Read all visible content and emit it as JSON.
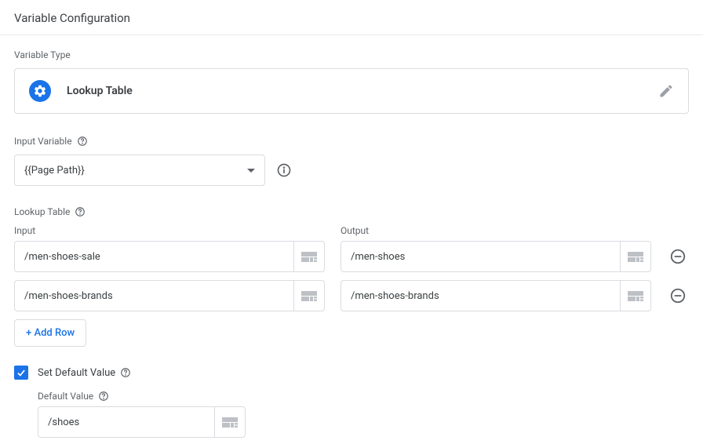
{
  "header": {
    "title": "Variable Configuration"
  },
  "variableType": {
    "label": "Variable Type",
    "name": "Lookup Table"
  },
  "inputVariable": {
    "label": "Input Variable",
    "value": "{{Page Path}}"
  },
  "lookupTable": {
    "label": "Lookup Table",
    "inputHeader": "Input",
    "outputHeader": "Output",
    "rows": [
      {
        "input": "/men-shoes-sale",
        "output": "/men-shoes"
      },
      {
        "input": "/men-shoes-brands",
        "output": "/men-shoes-brands"
      }
    ],
    "addRowLabel": "+ Add Row"
  },
  "defaultValue": {
    "checkboxLabel": "Set Default Value",
    "checked": true,
    "fieldLabel": "Default Value",
    "value": "/shoes"
  }
}
